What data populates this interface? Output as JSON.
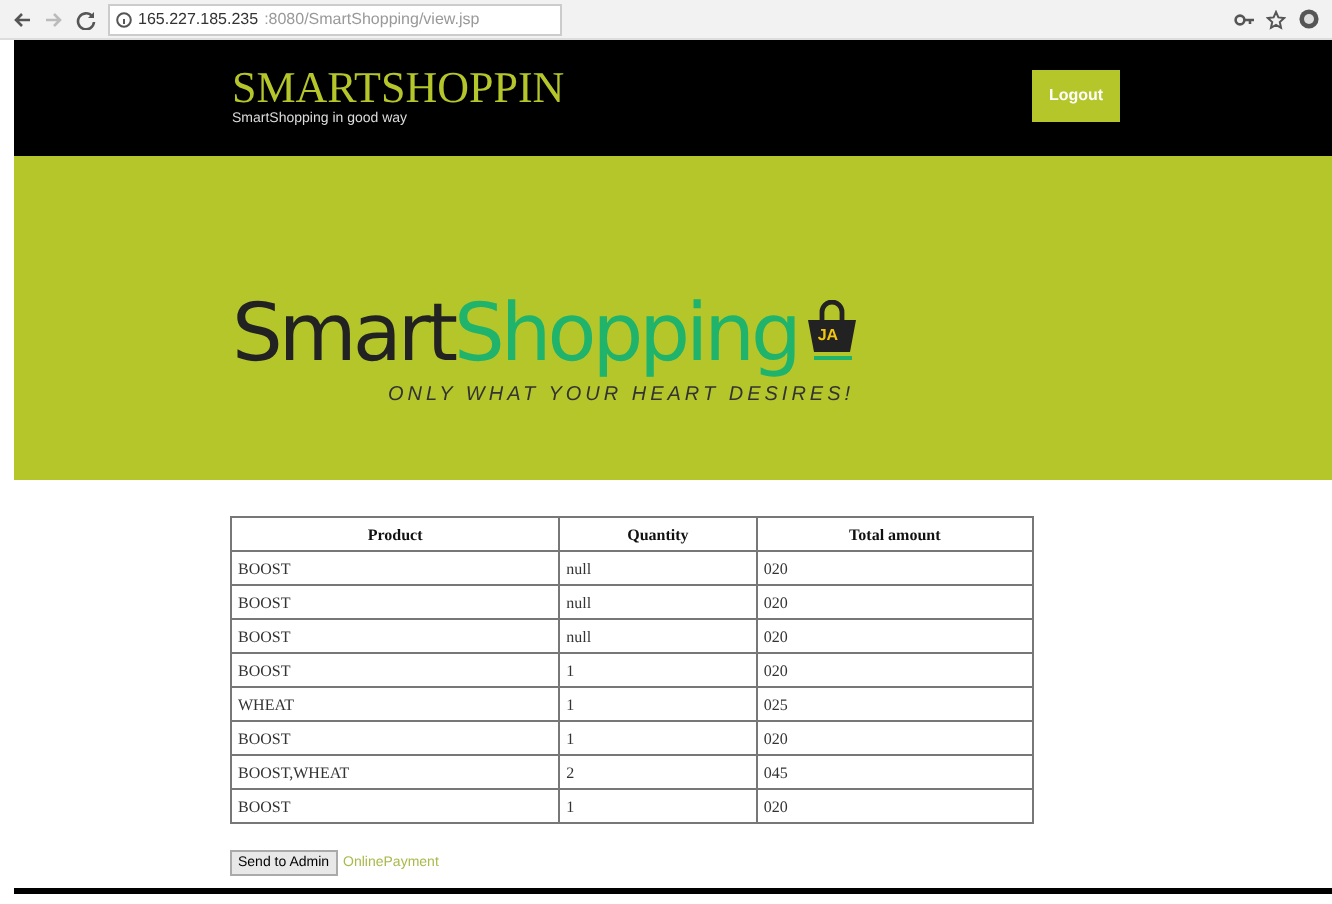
{
  "browser": {
    "url_host": "165.227.185.235",
    "url_rest": ":8080/SmartShopping/view.jsp"
  },
  "header": {
    "title": "SMARTSHOPPIN",
    "subtitle": "SmartShopping in good way",
    "logout": "Logout"
  },
  "banner": {
    "logo_dark": "Smart",
    "logo_green": "Shopping",
    "badge": "JA",
    "tagline": "ONLY WHAT YOUR HEART DESIRES!"
  },
  "table": {
    "columns": [
      "Product",
      "Quantity",
      "Total amount"
    ],
    "rows": [
      [
        "BOOST",
        "null",
        "020"
      ],
      [
        "BOOST",
        "null",
        "020"
      ],
      [
        "BOOST",
        "null",
        "020"
      ],
      [
        "BOOST",
        "1",
        "020"
      ],
      [
        "WHEAT",
        "1",
        "025"
      ],
      [
        "BOOST",
        "1",
        "020"
      ],
      [
        "BOOST,WHEAT",
        "2",
        "045"
      ],
      [
        "BOOST",
        "1",
        "020"
      ]
    ]
  },
  "actions": {
    "button": "Send to Admin",
    "link": "OnlinePayment"
  }
}
